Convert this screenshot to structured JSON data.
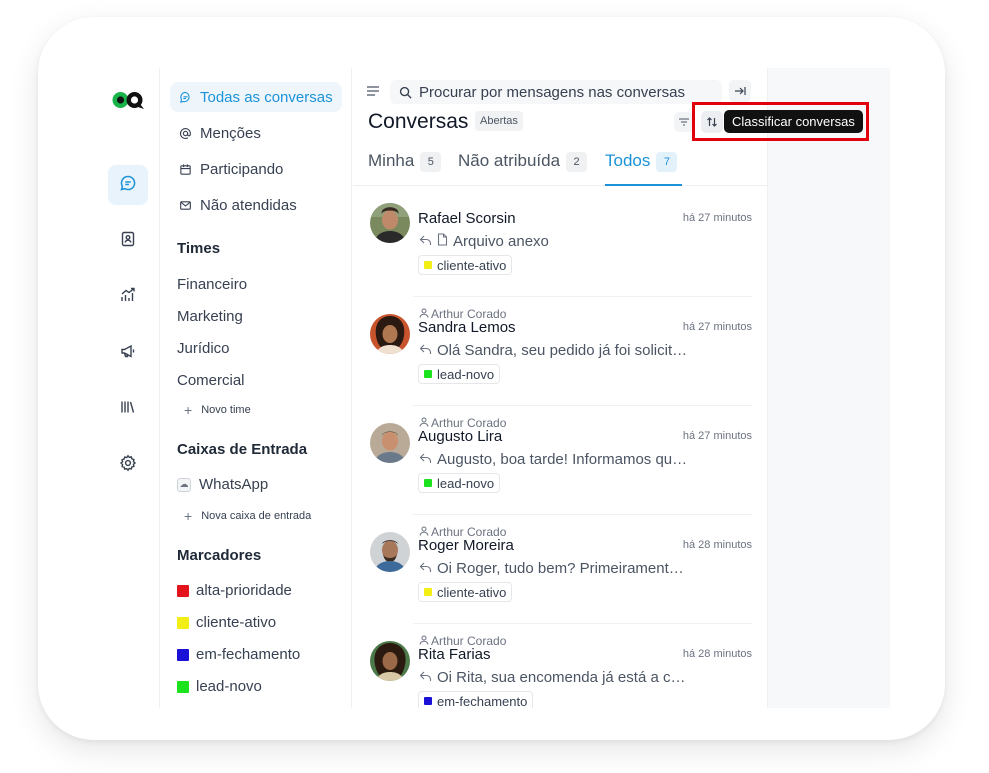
{
  "sidebar": {
    "nav": [
      {
        "label": "Todas as conversas",
        "icon": "chat-bubble-icon"
      },
      {
        "label": "Menções",
        "icon": "at-sign-icon"
      },
      {
        "label": "Participando",
        "icon": "calendar-icon"
      },
      {
        "label": "Não atendidas",
        "icon": "envelope-icon"
      }
    ],
    "teams_title": "Times",
    "teams": [
      "Financeiro",
      "Marketing",
      "Jurídico",
      "Comercial"
    ],
    "new_team": "Novo time",
    "inboxes_title": "Caixas de Entrada",
    "inboxes": [
      {
        "label": "WhatsApp",
        "icon": "cloud-icon"
      }
    ],
    "new_inbox": "Nova caixa de entrada",
    "labels_title": "Marcadores",
    "labels": [
      {
        "label": "alta-prioridade",
        "color": "#e3141b"
      },
      {
        "label": "cliente-ativo",
        "color": "#f2ee16"
      },
      {
        "label": "em-fechamento",
        "color": "#1a10d6"
      },
      {
        "label": "lead-novo",
        "color": "#1ce31d"
      }
    ]
  },
  "rail": {
    "items": [
      "conversations-icon",
      "contacts-icon",
      "reports-icon",
      "campaigns-icon",
      "library-icon",
      "settings-icon"
    ],
    "active": "conversations-icon"
  },
  "list": {
    "search_placeholder": "Procurar por mensagens nas conversas",
    "title": "Conversas",
    "status": "Abertas",
    "tabs": [
      {
        "label": "Minha",
        "count": "5"
      },
      {
        "label": "Não atribuída",
        "count": "2"
      },
      {
        "label": "Todos",
        "count": "7"
      }
    ],
    "active_tab": "Todos",
    "tooltip": "Classificar conversas",
    "conversations": [
      {
        "assignee": "",
        "name": "Rafael Scorsin",
        "time": "há 27 minutos",
        "message": "Arquivo anexo",
        "attachment": true,
        "tag": "cliente-ativo",
        "tag_color": "#f2ee16"
      },
      {
        "assignee": "Arthur Corado",
        "name": "Sandra Lemos",
        "time": "há 27 minutos",
        "message": "Olá Sandra, seu pedido já foi solicitado",
        "attachment": false,
        "tag": "lead-novo",
        "tag_color": "#1ce31d"
      },
      {
        "assignee": "Arthur Corado",
        "name": "Augusto Lira",
        "time": "há 27 minutos",
        "message": "Augusto, boa tarde! Informamos que seu",
        "attachment": false,
        "tag": "lead-novo",
        "tag_color": "#1ce31d"
      },
      {
        "assignee": "Arthur Corado",
        "name": "Roger Moreira",
        "time": "há 28 minutos",
        "message": "Oi Roger, tudo bem? Primeiramente gostaria",
        "attachment": false,
        "tag": "cliente-ativo",
        "tag_color": "#f2ee16"
      },
      {
        "assignee": "Arthur Corado",
        "name": "Rita Farias",
        "time": "há 28 minutos",
        "message": "Oi Rita, sua encomenda já está a caminho",
        "attachment": false,
        "tag": "em-fechamento",
        "tag_color": "#1a10d6"
      }
    ]
  }
}
